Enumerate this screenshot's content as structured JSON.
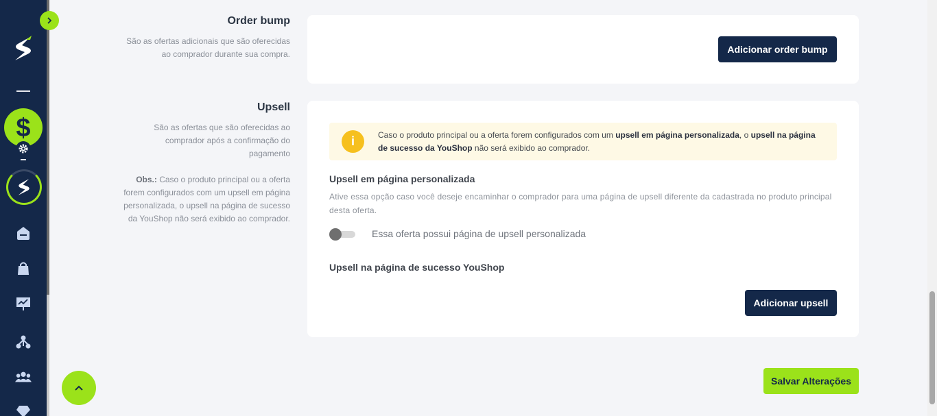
{
  "sidebar": {
    "expand_icon": "chevron-right-icon",
    "logo": "youshop-logo",
    "items": [
      {
        "icon": "dollar-icon"
      },
      {
        "icon": "gear-icon"
      },
      {
        "icon": "youshop-ring-icon"
      },
      {
        "icon": "home-icon"
      },
      {
        "icon": "shopping-bag-icon"
      },
      {
        "icon": "presentation-chart-icon"
      },
      {
        "icon": "network-icon"
      },
      {
        "icon": "users-icon"
      },
      {
        "icon": "diamond-icon"
      }
    ]
  },
  "order_bump": {
    "title": "Order bump",
    "description": "São as ofertas adicionais que são oferecidas ao comprador durante sua compra.",
    "button_label": "Adicionar order bump"
  },
  "upsell": {
    "title": "Upsell",
    "description": "São as ofertas que são oferecidas ao comprador após a confirmação do pagamento",
    "obs_label": "Obs.:",
    "obs_text": " Caso o produto principal ou a oferta forem configurados com um upsell em página personalizada, o upsell na página de sucesso da YouShop não será exibido ao comprador.",
    "alert": {
      "part1": "Caso o produto principal ou a oferta forem configurados com um ",
      "bold1": "upsell em página personalizada",
      "part2": ", o ",
      "bold2": "upsell na página de sucesso da YouShop",
      "part3": " não será exibido ao comprador."
    },
    "custom_page_title": "Upsell em página personalizada",
    "custom_page_desc": "Ative essa opção caso você deseje encaminhar o comprador para uma página de upsell diferente da cadastrada no produto principal desta oferta.",
    "toggle_label": "Essa oferta possui página de upsell personalizada",
    "toggle_on": false,
    "success_page_title": "Upsell na página de sucesso YouShop",
    "button_label": "Adicionar upsell"
  },
  "save_label": "Salvar Alterações",
  "colors": {
    "sidebar": "#142849",
    "accent": "#9be21a",
    "button_dark": "#142849",
    "alert_bg": "#fef9e5",
    "alert_icon": "#f6c01e"
  }
}
